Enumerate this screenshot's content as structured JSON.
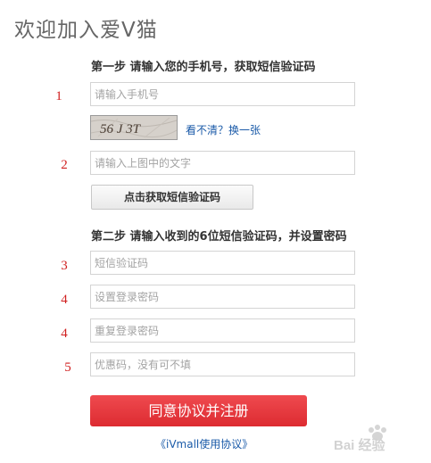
{
  "page": {
    "title": "欢迎加入爱V猫"
  },
  "step1": {
    "heading": "第一步  请输入您的手机号，获取短信验证码",
    "phone": {
      "number": "1",
      "placeholder": "请输入手机号",
      "value": ""
    },
    "captcha": {
      "text": "56 J 3T",
      "refresh_label": "看不清？换一张"
    },
    "captcha_input": {
      "number": "2",
      "placeholder": "请输入上图中的文字",
      "value": ""
    },
    "sms_button_label": "点击获取短信验证码"
  },
  "step2": {
    "heading": "第二步  请输入收到的6位短信验证码，并设置密码",
    "fields": [
      {
        "number": "3",
        "placeholder": "短信验证码",
        "value": ""
      },
      {
        "number": "4",
        "placeholder": "设置登录密码",
        "value": ""
      },
      {
        "number": "4",
        "placeholder": "重复登录密码",
        "value": ""
      },
      {
        "number": "5",
        "placeholder": "优惠码，没有可不填",
        "value": ""
      }
    ]
  },
  "actions": {
    "register_label": "同意协议并注册",
    "agreement_label": "《iVmall使用协议》"
  },
  "watermark": {
    "text": "Bai 经验"
  },
  "colors": {
    "accent_red": "#e03a3f",
    "link_blue": "#1a5aa8",
    "number_red": "#d02020"
  }
}
